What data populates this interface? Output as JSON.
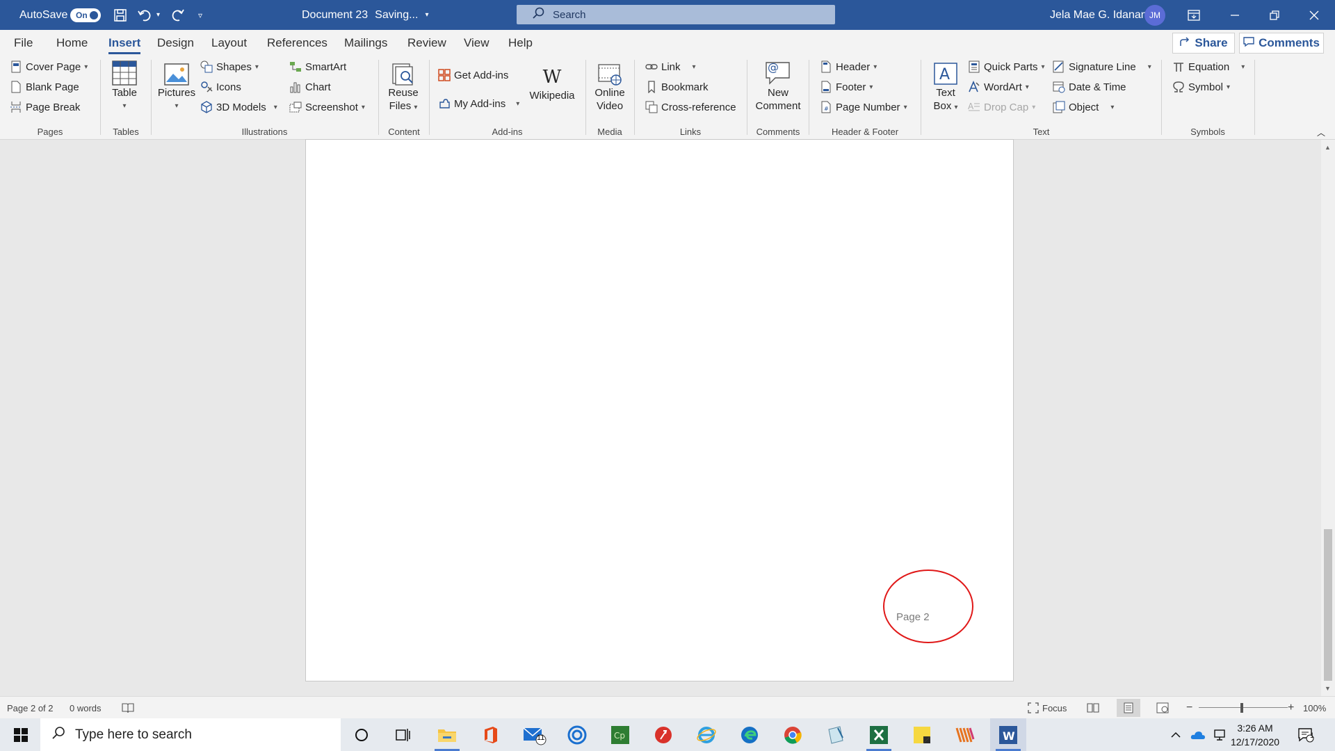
{
  "titlebar": {
    "autosave_label": "AutoSave",
    "autosave_state": "On",
    "document_title": "Document 23",
    "save_status": "Saving...",
    "search_placeholder": "Search",
    "user_name": "Jela Mae G. Idanan",
    "user_initials": "JM"
  },
  "tabs": [
    "File",
    "Home",
    "Insert",
    "Design",
    "Layout",
    "References",
    "Mailings",
    "Review",
    "View",
    "Help"
  ],
  "active_tab": "Insert",
  "share_label": "Share",
  "comments_label": "Comments",
  "ribbon": {
    "pages": {
      "cover_page": "Cover Page",
      "blank_page": "Blank Page",
      "page_break": "Page Break",
      "group": "Pages"
    },
    "tables": {
      "table": "Table",
      "group": "Tables"
    },
    "illustrations": {
      "pictures": "Pictures",
      "shapes": "Shapes",
      "icons": "Icons",
      "models": "3D Models",
      "smartart": "SmartArt",
      "chart": "Chart",
      "screenshot": "Screenshot",
      "group": "Illustrations"
    },
    "content": {
      "reuse_line1": "Reuse",
      "reuse_line2": "Files",
      "group": "Content"
    },
    "addins": {
      "get_addins": "Get Add-ins",
      "my_addins": "My Add-ins",
      "wikipedia": "Wikipedia",
      "group": "Add-ins"
    },
    "media": {
      "online_line1": "Online",
      "online_line2": "Video",
      "group": "Media"
    },
    "links": {
      "link": "Link",
      "bookmark": "Bookmark",
      "cross_reference": "Cross-reference",
      "group": "Links"
    },
    "comments": {
      "new_line1": "New",
      "new_line2": "Comment",
      "group": "Comments"
    },
    "header_footer": {
      "header": "Header",
      "footer": "Footer",
      "page_number": "Page Number",
      "group": "Header & Footer"
    },
    "text": {
      "textbox_line1": "Text",
      "textbox_line2": "Box",
      "quick_parts": "Quick Parts",
      "wordart": "WordArt",
      "drop_cap": "Drop Cap",
      "signature_line": "Signature Line",
      "date_time": "Date & Time",
      "object": "Object",
      "group": "Text"
    },
    "symbols": {
      "equation": "Equation",
      "symbol": "Symbol",
      "group": "Symbols"
    }
  },
  "document": {
    "page_footer_text": "Page 2"
  },
  "statusbar": {
    "page_info": "Page 2 of 2",
    "word_count": "0 words",
    "focus": "Focus",
    "zoom": "100%",
    "zoom_minus": "−",
    "zoom_plus": "+"
  },
  "taskbar": {
    "search_placeholder": "Type here to search",
    "mail_badge": "11",
    "time": "3:26 AM",
    "date": "12/17/2020",
    "notification_count": "1"
  },
  "colors": {
    "word_blue": "#2b579a",
    "highlight_red": "#e01818"
  }
}
